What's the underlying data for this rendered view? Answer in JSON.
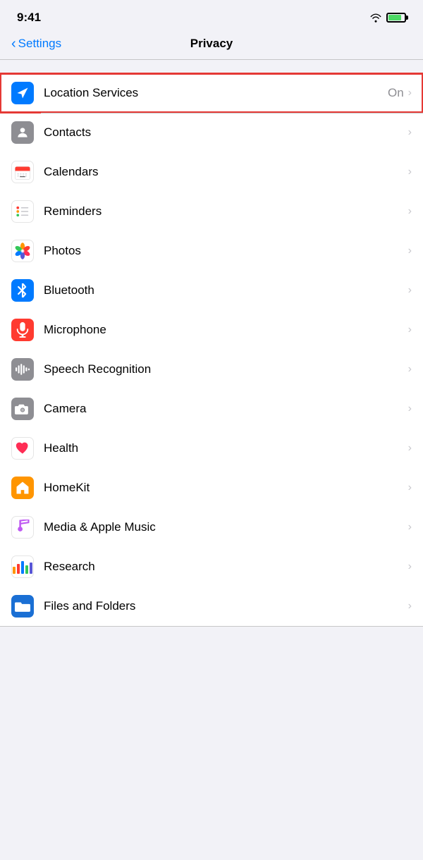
{
  "statusBar": {
    "time": "9:41"
  },
  "navBar": {
    "backLabel": "Settings",
    "title": "Privacy"
  },
  "rows": [
    {
      "id": "location-services",
      "label": "Location Services",
      "value": "On",
      "hasChevron": true,
      "highlighted": true,
      "iconType": "location"
    },
    {
      "id": "contacts",
      "label": "Contacts",
      "value": "",
      "hasChevron": true,
      "iconType": "contacts"
    },
    {
      "id": "calendars",
      "label": "Calendars",
      "value": "",
      "hasChevron": true,
      "iconType": "calendars"
    },
    {
      "id": "reminders",
      "label": "Reminders",
      "value": "",
      "hasChevron": true,
      "iconType": "reminders"
    },
    {
      "id": "photos",
      "label": "Photos",
      "value": "",
      "hasChevron": true,
      "iconType": "photos"
    },
    {
      "id": "bluetooth",
      "label": "Bluetooth",
      "value": "",
      "hasChevron": true,
      "iconType": "bluetooth"
    },
    {
      "id": "microphone",
      "label": "Microphone",
      "value": "",
      "hasChevron": true,
      "iconType": "microphone"
    },
    {
      "id": "speech-recognition",
      "label": "Speech Recognition",
      "value": "",
      "hasChevron": true,
      "iconType": "speech"
    },
    {
      "id": "camera",
      "label": "Camera",
      "value": "",
      "hasChevron": true,
      "iconType": "camera"
    },
    {
      "id": "health",
      "label": "Health",
      "value": "",
      "hasChevron": true,
      "iconType": "health"
    },
    {
      "id": "homekit",
      "label": "HomeKit",
      "value": "",
      "hasChevron": true,
      "iconType": "homekit"
    },
    {
      "id": "media-apple-music",
      "label": "Media & Apple Music",
      "value": "",
      "hasChevron": true,
      "iconType": "music"
    },
    {
      "id": "research",
      "label": "Research",
      "value": "",
      "hasChevron": true,
      "iconType": "research"
    },
    {
      "id": "files-and-folders",
      "label": "Files and Folders",
      "value": "",
      "hasChevron": true,
      "iconType": "files"
    }
  ]
}
